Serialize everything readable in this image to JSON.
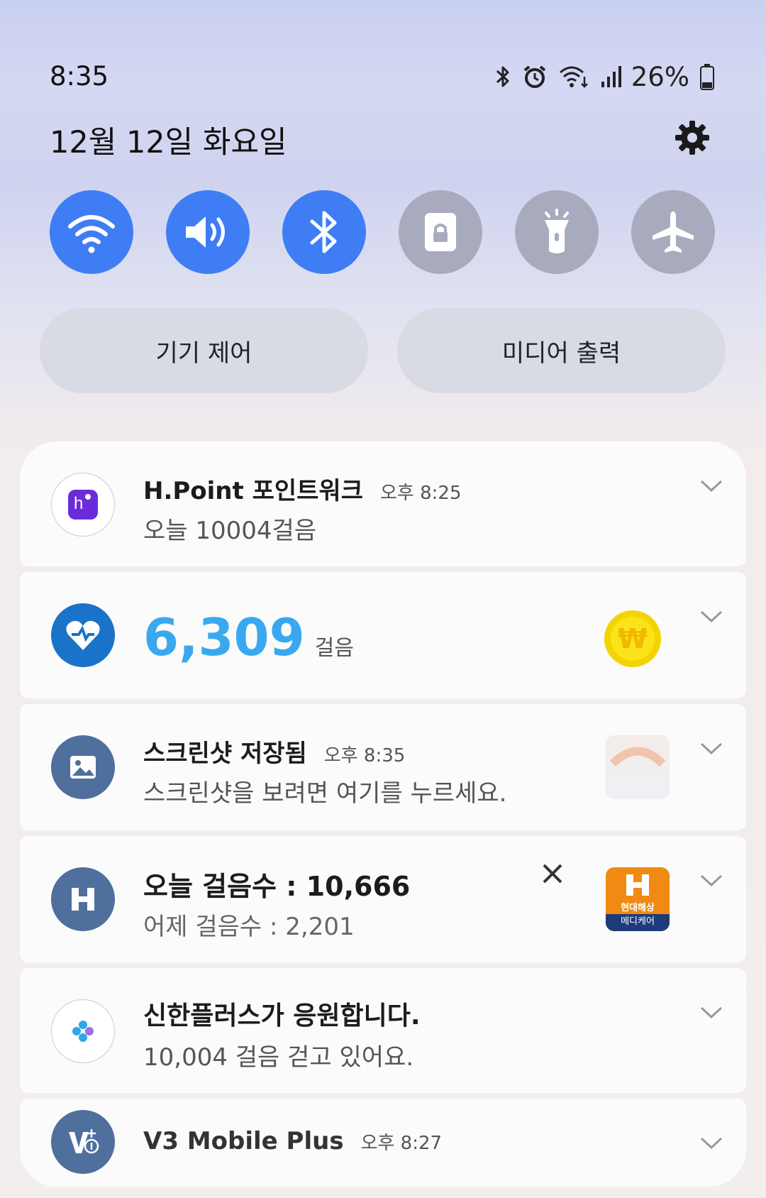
{
  "status": {
    "time": "8:35",
    "battery": "26%"
  },
  "header": {
    "date": "12월 12일 화요일"
  },
  "quick_settings": [
    {
      "name": "wifi",
      "on": true
    },
    {
      "name": "sound",
      "on": true
    },
    {
      "name": "bluetooth",
      "on": true
    },
    {
      "name": "screen-lock-rotation",
      "on": false
    },
    {
      "name": "flashlight",
      "on": false
    },
    {
      "name": "airplane",
      "on": false
    }
  ],
  "pills": {
    "device_control": "기기 제어",
    "media_output": "미디어 출력"
  },
  "notifications": {
    "hpoint": {
      "title": "H.Point 포인트워크",
      "time": "오후 8:25",
      "text": "오늘 10004걸음"
    },
    "steps": {
      "value": "6,309",
      "unit": "걸음"
    },
    "screenshot": {
      "title": "스크린샷 저장됨",
      "time": "오후 8:35",
      "text": "스크린샷을 보려면 여기를 누르세요."
    },
    "hyundai": {
      "title": "오늘 걸음수 : 10,666",
      "text": "어제 걸음수 : 2,201",
      "logo_line1": "현대해상",
      "logo_line2": "메디케어"
    },
    "shinhan": {
      "title": "신한플러스가 응원합니다.",
      "text": "10,004 걸음 걷고 있어요."
    },
    "v3": {
      "title": "V3 Mobile Plus",
      "time": "오후 8:27"
    }
  },
  "colors": {
    "accent": "#3f7df5",
    "steps_blue": "#3aa8ef",
    "icon_dark_blue": "#4f6f9d"
  }
}
